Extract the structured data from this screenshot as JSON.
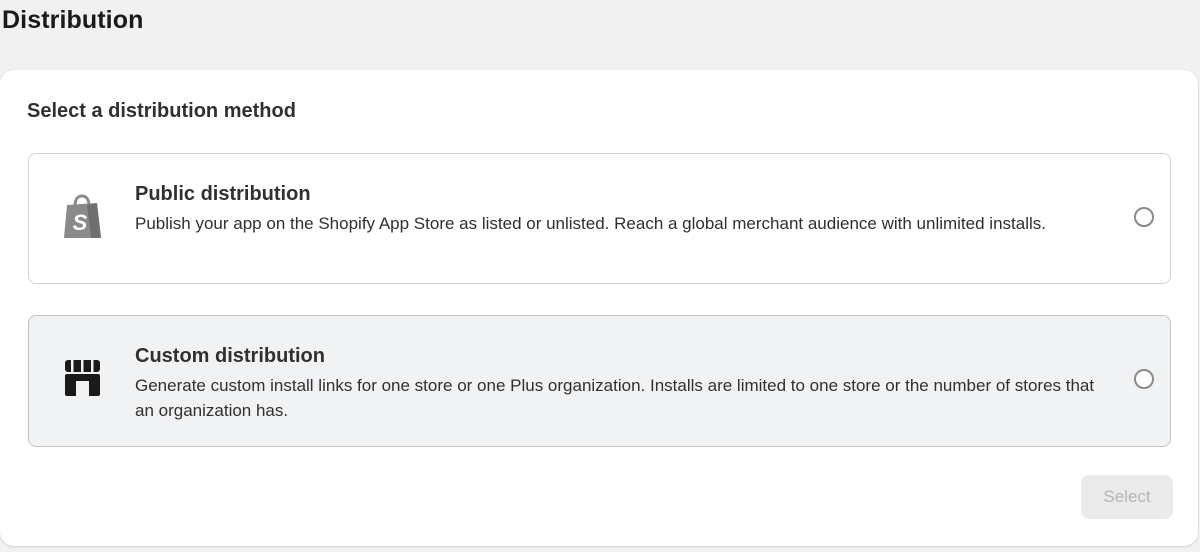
{
  "page": {
    "title": "Distribution"
  },
  "card": {
    "heading": "Select a distribution method",
    "options": [
      {
        "id": "public",
        "icon": "shopify-bag-icon",
        "title": "Public distribution",
        "description": "Publish your app on the Shopify App Store as listed or unlisted. Reach a global merchant audience with unlimited installs.",
        "selected": false
      },
      {
        "id": "custom",
        "icon": "store-icon",
        "title": "Custom distribution",
        "description": "Generate custom install links for one store or one Plus organization. Installs are limited to one store or the number of stores that an organization has.",
        "selected": false
      }
    ],
    "select_button_label": "Select",
    "select_button_disabled": true
  },
  "colors": {
    "page_background": "#f1f1f1",
    "card_background": "#ffffff",
    "hover_option_background": "#f1f2f4",
    "icon_gray": "#8a8a8a",
    "icon_dark": "#1a1a1a",
    "disabled_button_background": "#ebebeb",
    "disabled_button_text": "#b5b5b5"
  }
}
